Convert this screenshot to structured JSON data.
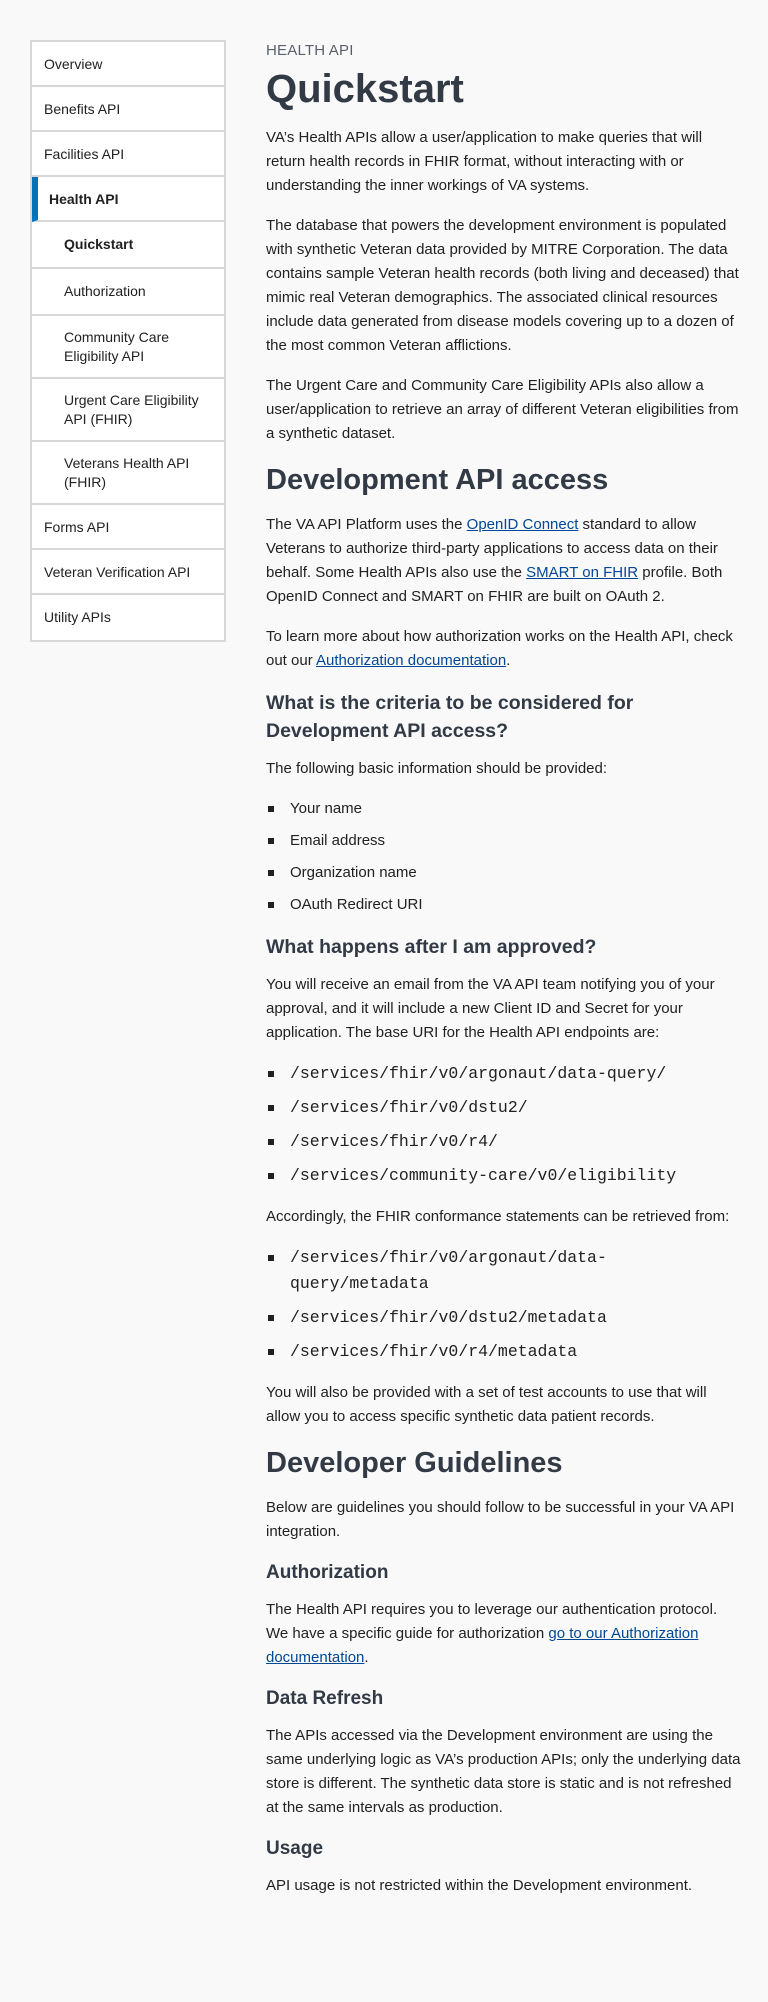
{
  "sidebar": {
    "items": [
      {
        "label": "Overview"
      },
      {
        "label": "Benefits API"
      },
      {
        "label": "Facilities API"
      },
      {
        "label": "Health API"
      },
      {
        "label": "Quickstart"
      },
      {
        "label": "Authorization"
      },
      {
        "label": "Community Care Eligibility API"
      },
      {
        "label": "Urgent Care Eligibility API (FHIR)"
      },
      {
        "label": "Veterans Health API (FHIR)"
      },
      {
        "label": "Forms API"
      },
      {
        "label": "Veteran Verification API"
      },
      {
        "label": "Utility APIs"
      }
    ]
  },
  "header": {
    "eyebrow": "HEALTH API",
    "title": "Quickstart"
  },
  "intro": {
    "p1": "VA’s Health APIs allow a user/application to make queries that will return health records in FHIR format, without interacting with or understanding the inner workings of VA systems.",
    "p2": "The database that powers the development environment is populated with synthetic Veteran data provided by MITRE Corporation. The data contains sample Veteran health records (both living and deceased) that mimic real Veteran demographics. The associated clinical resources include data generated from disease models covering up to a dozen of the most common Veteran afflictions.",
    "p3": "The Urgent Care and Community Care Eligibility APIs also allow a user/application to retrieve an array of different Veteran eligibilities from a synthetic dataset."
  },
  "dev_access": {
    "heading": "Development API access",
    "p1_a": "The VA API Platform uses the ",
    "p1_link1": "OpenID Connect",
    "p1_b": " standard to allow Veterans to authorize third-party applications to access data on their behalf. Some Health APIs also use the ",
    "p1_link2": "SMART on FHIR",
    "p1_c": " profile. Both OpenID Connect and SMART on FHIR are built on OAuth 2.",
    "p2_a": "To learn more about how authorization works on the Health API, check out our ",
    "p2_link": "Authorization documentation",
    "p2_b": "."
  },
  "criteria": {
    "heading": "What is the criteria to be considered for Development API access?",
    "intro": "The following basic information should be provided:",
    "items": [
      "Your name",
      "Email address",
      "Organization name",
      "OAuth Redirect URI"
    ]
  },
  "approved": {
    "heading": "What happens after I am approved?",
    "p1": "You will receive an email from the VA API team notifying you of your approval, and it will include a new Client ID and Secret for your application. The base URI for the Health API endpoints are:",
    "endpoints": [
      "/services/fhir/v0/argonaut/data-query/",
      "/services/fhir/v0/dstu2/",
      "/services/fhir/v0/r4/",
      "/services/community-care/v0/eligibility"
    ],
    "p2": "Accordingly, the FHIR conformance statements can be retrieved from:",
    "metadata": [
      "/services/fhir/v0/argonaut/data-query/metadata",
      "/services/fhir/v0/dstu2/metadata",
      "/services/fhir/v0/r4/metadata"
    ],
    "p3": "You will also be provided with a set of test accounts to use that will allow you to access specific synthetic data patient records."
  },
  "guidelines": {
    "heading": "Developer Guidelines",
    "intro": "Below are guidelines you should follow to be successful in your VA API integration.",
    "auth_heading": "Authorization",
    "auth_a": "The Health API requires you to leverage our authentication protocol. We have a specific guide for authorization ",
    "auth_link": "go to our Authorization documentation",
    "auth_b": ".",
    "refresh_heading": "Data Refresh",
    "refresh_p": "The APIs accessed via the Development environment are using the same underlying logic as VA’s production APIs; only the underlying data store is different. The synthetic data store is static and is not refreshed at the same intervals as production.",
    "usage_heading": "Usage",
    "usage_p": "API usage is not restricted within the Development environment."
  }
}
